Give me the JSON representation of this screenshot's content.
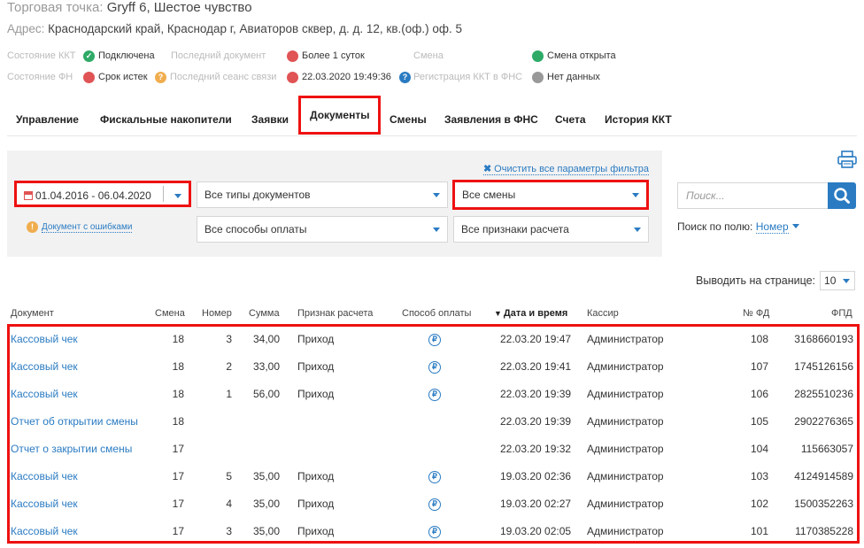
{
  "header": {
    "point_label": "Торговая точка:",
    "point_value": "Gryff 6, Шестое чувство",
    "address_label": "Адрес:",
    "address_value": "Краснодарский край, Краснодар г, Авиаторов сквер, д. д. 12, кв.(оф.) оф. 5"
  },
  "status": {
    "kkt_label": "Состояние ККТ",
    "kkt_value": "Подключена",
    "last_doc_label": "Последний документ",
    "last_doc_value": "Более 1 суток",
    "shift_label": "Смена",
    "shift_value": "Смена открыта",
    "fn_label": "Состояние ФН",
    "fn_value": "Срок истек",
    "last_session_label": "Последний сеанс связи",
    "last_session_value": "22.03.2020 19:49:36",
    "fns_reg_label": "Регистрация ККТ в ФНС",
    "fns_reg_value": "Нет данных"
  },
  "tabs": [
    "Управление",
    "Фискальные накопители",
    "Заявки",
    "Документы",
    "Смены",
    "Заявления в ФНС",
    "Счета",
    "История ККТ"
  ],
  "active_tab": "Документы",
  "filters": {
    "clear_all": "Очистить все параметры фильтра",
    "date_range": "01.04.2016 - 06.04.2020",
    "doc_types": "Все типы документов",
    "shifts": "Все смены",
    "error_docs": "Документ с ошибками",
    "payment_methods": "Все способы оплаты",
    "calc_signs": "Все признаки расчета"
  },
  "search": {
    "placeholder": "Поиск...",
    "field_label": "Поиск по полю:",
    "field_value": "Номер"
  },
  "pagination": {
    "per_page_label": "Выводить на странице:",
    "per_page_value": "10"
  },
  "table": {
    "columns": [
      "Документ",
      "Смена",
      "Номер",
      "Сумма",
      "Признак расчета",
      "Способ оплаты",
      "Дата и время",
      "Кассир",
      "№ ФД",
      "ФПД"
    ],
    "sorted_column": "Дата и время",
    "rows": [
      {
        "doc": "Кассовый чек",
        "shift": "18",
        "num": "3",
        "sum": "34,00",
        "sign": "Приход",
        "pay": "₽",
        "dt": "22.03.20 19:47",
        "cashier": "Администратор",
        "fd": "108",
        "fpd": "3168660193"
      },
      {
        "doc": "Кассовый чек",
        "shift": "18",
        "num": "2",
        "sum": "33,00",
        "sign": "Приход",
        "pay": "₽",
        "dt": "22.03.20 19:41",
        "cashier": "Администратор",
        "fd": "107",
        "fpd": "1745126156"
      },
      {
        "doc": "Кассовый чек",
        "shift": "18",
        "num": "1",
        "sum": "56,00",
        "sign": "Приход",
        "pay": "₽",
        "dt": "22.03.20 19:39",
        "cashier": "Администратор",
        "fd": "106",
        "fpd": "2825510236"
      },
      {
        "doc": "Отчет об открытии смены",
        "shift": "18",
        "num": "",
        "sum": "",
        "sign": "",
        "pay": "",
        "dt": "22.03.20 19:39",
        "cashier": "Администратор",
        "fd": "105",
        "fpd": "2902276365"
      },
      {
        "doc": "Отчет о закрытии смены",
        "shift": "17",
        "num": "",
        "sum": "",
        "sign": "",
        "pay": "",
        "dt": "22.03.20 19:32",
        "cashier": "Администратор",
        "fd": "104",
        "fpd": "115663057"
      },
      {
        "doc": "Кассовый чек",
        "shift": "17",
        "num": "5",
        "sum": "35,00",
        "sign": "Приход",
        "pay": "₽",
        "dt": "19.03.20 02:36",
        "cashier": "Администратор",
        "fd": "103",
        "fpd": "4124914589"
      },
      {
        "doc": "Кассовый чек",
        "shift": "17",
        "num": "4",
        "sum": "35,00",
        "sign": "Приход",
        "pay": "₽",
        "dt": "19.03.20 02:27",
        "cashier": "Администратор",
        "fd": "102",
        "fpd": "1500352263"
      },
      {
        "doc": "Кассовый чек",
        "shift": "17",
        "num": "3",
        "sum": "35,00",
        "sign": "Приход",
        "pay": "₽",
        "dt": "19.03.20 02:05",
        "cashier": "Администратор",
        "fd": "101",
        "fpd": "1170385228"
      }
    ]
  }
}
